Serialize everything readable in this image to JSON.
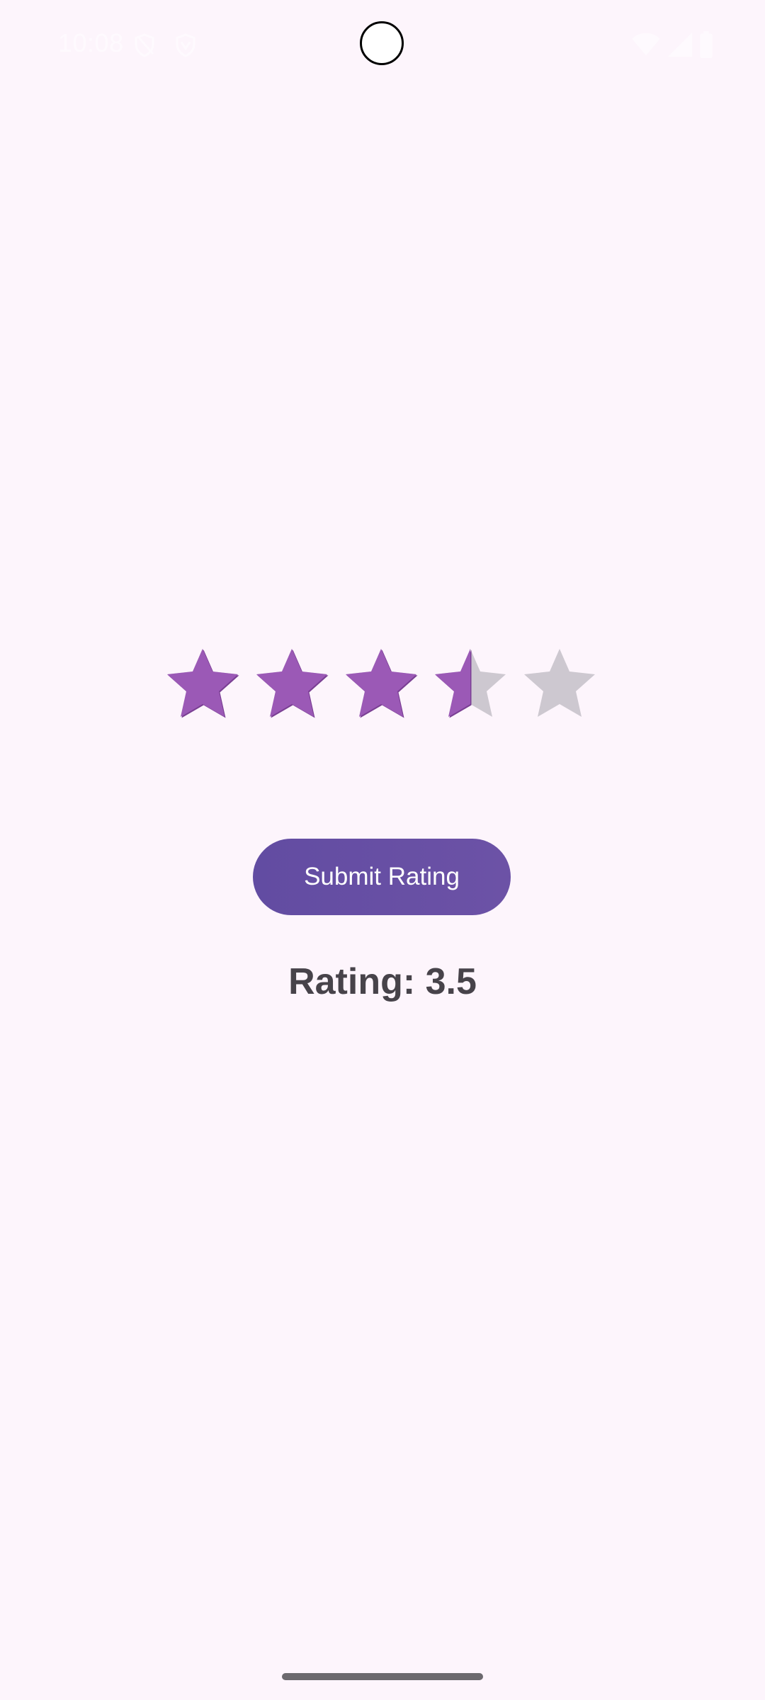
{
  "status_bar": {
    "time": "10:08",
    "left_icons": [
      "shield-icon",
      "vpn-shield-icon"
    ],
    "right_icons": [
      "wifi-icon",
      "signal-icon",
      "battery-icon"
    ],
    "icon_color": "#fefafe"
  },
  "rating_bar": {
    "value": 3.5,
    "max": 5,
    "star_filled_color": "#9b59b6",
    "star_empty_color": "#cdc8d0"
  },
  "submit_button": {
    "label": "Submit Rating",
    "color": "#6750a4"
  },
  "rating_display": {
    "text": "Rating: 3.5"
  },
  "colors": {
    "background": "#fdf5fc",
    "text": "#47434a"
  }
}
